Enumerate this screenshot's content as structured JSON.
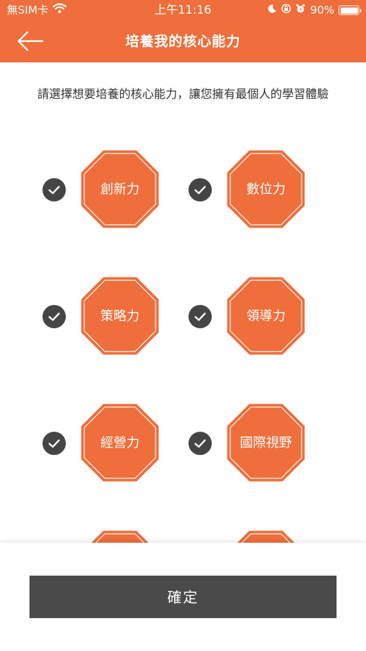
{
  "status_bar": {
    "carrier": "無SIM卡",
    "time": "上午11:16",
    "battery": "90%"
  },
  "navbar": {
    "title": "培養我的核心能力",
    "back_icon": "arrow-left-icon"
  },
  "instruction": "請選擇想要培養的核心能力，讓您擁有最個人的學習體驗",
  "capabilities": [
    {
      "label": "創新力",
      "checked": true
    },
    {
      "label": "數位力",
      "checked": true
    },
    {
      "label": "策略力",
      "checked": true
    },
    {
      "label": "領導力",
      "checked": true
    },
    {
      "label": "經營力",
      "checked": true
    },
    {
      "label": "國際視野",
      "checked": true
    },
    {
      "label": "",
      "checked": false
    },
    {
      "label": "",
      "checked": false
    }
  ],
  "confirm_label": "確定",
  "colors": {
    "brand": "#ef6e3b",
    "check_bg": "#454545",
    "button_bg": "#4a4a4a"
  }
}
